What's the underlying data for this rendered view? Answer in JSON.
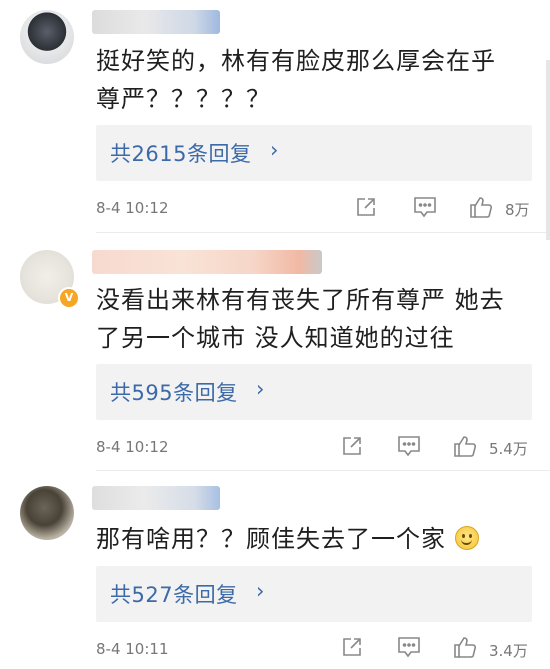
{
  "comments": [
    {
      "text_line1": "挺好笑的，林有有脸皮那么厚会在乎",
      "text_line2": "尊严？？？？？",
      "replies_label": "共2615条回复",
      "time": "8-4 10:12",
      "likes": "8万"
    },
    {
      "text_line1": "没看出来林有有丧失了所有尊严  她去",
      "text_line2": "了另一个城市 没人知道她的过往",
      "replies_label": "共595条回复",
      "time": "8-4 10:12",
      "likes": "5.4万"
    },
    {
      "text_line1": "那有啥用？？顾佳失去了一个家",
      "replies_label": "共527条回复",
      "time": "8-4 10:11",
      "likes": "3.4万"
    }
  ],
  "icons": {
    "chevron": "chevron-right-icon",
    "share": "share-icon",
    "comment": "comment-icon",
    "like": "thumbs-up-icon",
    "emoji": "smile-emoji-icon"
  },
  "colors": {
    "link": "#3c6aa8",
    "reply_box": "#f2f2f2",
    "meta": "#777777",
    "verified_badge": "#f5a623"
  },
  "verified_badge_glyph": "V",
  "chevron_glyph": "›"
}
